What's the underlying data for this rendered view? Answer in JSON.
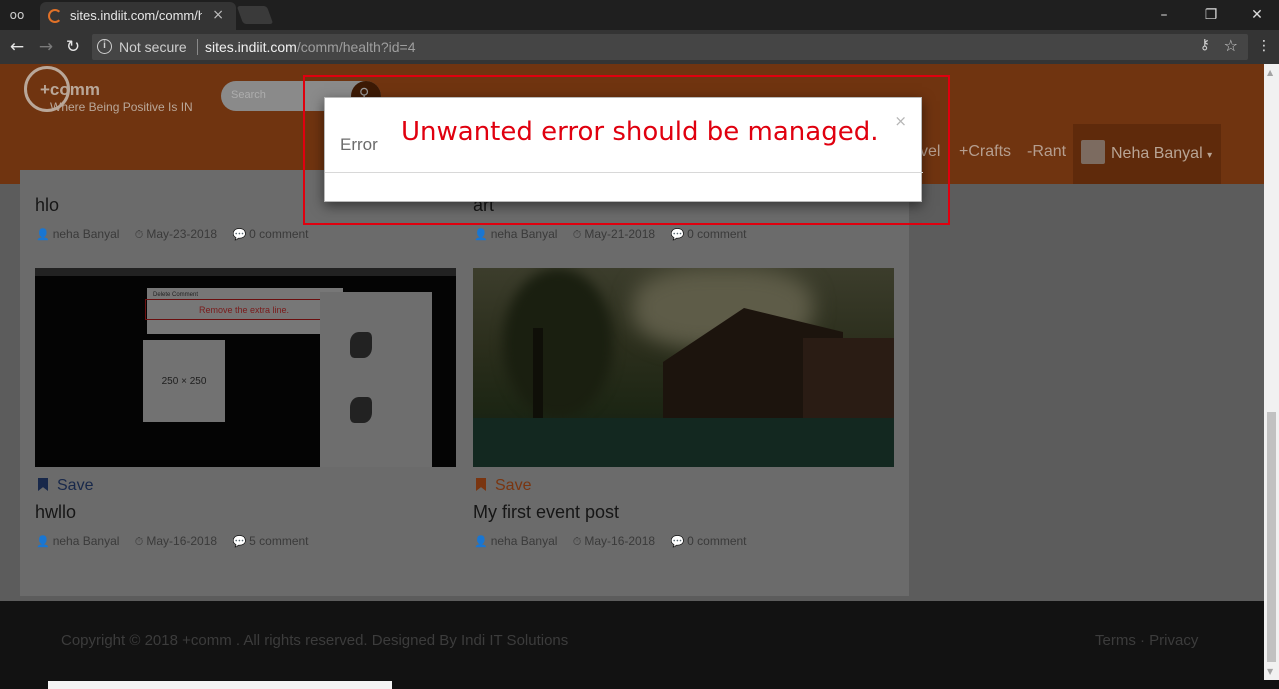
{
  "browser": {
    "tab_title": "sites.indiit.com/comm/he",
    "tab_close": "×",
    "security_label": "Not secure",
    "url_host": "sites.indiit.com",
    "url_path": "/comm/health?id=4"
  },
  "header": {
    "logo_text": "+comm",
    "tagline": "Where Being Positive Is IN",
    "search_placeholder": "Search",
    "nav": {
      "travel": "vel",
      "crafts": "+Crafts",
      "rant": "-Rant"
    },
    "user_name": "Neha Banyal"
  },
  "posts": [
    {
      "title": "hlo",
      "author": "neha Banyal",
      "date": "May-23-2018",
      "comments": "0 comment"
    },
    {
      "title": "art",
      "author": "neha Banyal",
      "date": "May-21-2018",
      "comments": "0 comment"
    },
    {
      "save_label": "Save",
      "save_color": "#18284a",
      "title": "hwllo",
      "author": "neha Banyal",
      "date": "May-16-2018",
      "comments": "5 comment"
    },
    {
      "save_label": "Save",
      "save_color": "#7a3510",
      "title": "My first event post",
      "author": "neha Banyal",
      "date": "May-16-2018",
      "comments": "0 comment"
    }
  ],
  "screenshot_thumb": {
    "modal_title": "Delete Comment",
    "modal_annotation": "Remove the extra line.",
    "ad_label": "250 × 250"
  },
  "footer": {
    "copyright": "Copyright © 2018 +comm . All rights reserved. Designed By Indi IT Solutions",
    "links": "Terms · Privacy"
  },
  "modal": {
    "title": "Error",
    "close": "×",
    "annotation": "Unwanted error should be managed.",
    "annotation_color": "#e0000f"
  }
}
